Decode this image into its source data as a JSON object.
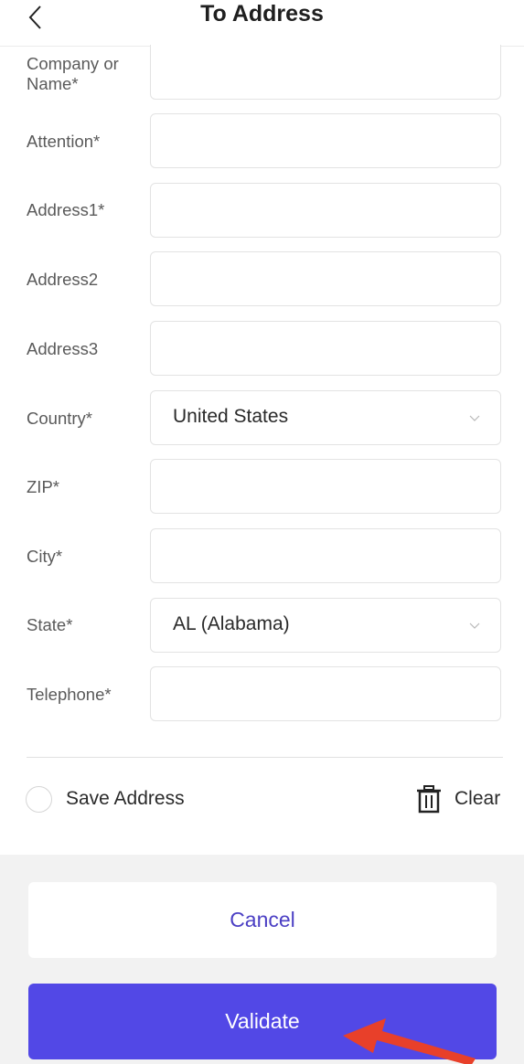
{
  "header": {
    "title": "To Address",
    "back_icon": "chevron-left-icon"
  },
  "form": {
    "fields": [
      {
        "label": "Company or\nName*",
        "value": ""
      },
      {
        "label": "Attention*",
        "value": ""
      },
      {
        "label": "Address1*",
        "value": ""
      },
      {
        "label": "Address2",
        "value": ""
      },
      {
        "label": "Address3",
        "value": ""
      },
      {
        "label": "Country*",
        "value": "United States",
        "type": "select"
      },
      {
        "label": "ZIP*",
        "value": ""
      },
      {
        "label": "City*",
        "value": ""
      },
      {
        "label": "State*",
        "value": "AL (Alabama)",
        "type": "select"
      },
      {
        "label": "Telephone*",
        "value": ""
      }
    ]
  },
  "options": {
    "save_label": "Save Address",
    "clear_label": "Clear",
    "trash_icon": "trash-icon"
  },
  "buttons": {
    "cancel": "Cancel",
    "validate": "Validate"
  },
  "colors": {
    "accent": "#5248e6",
    "cancel_text": "#4b3fc4",
    "arrow": "#e8402a",
    "footer_bg": "#f2f2f2"
  }
}
